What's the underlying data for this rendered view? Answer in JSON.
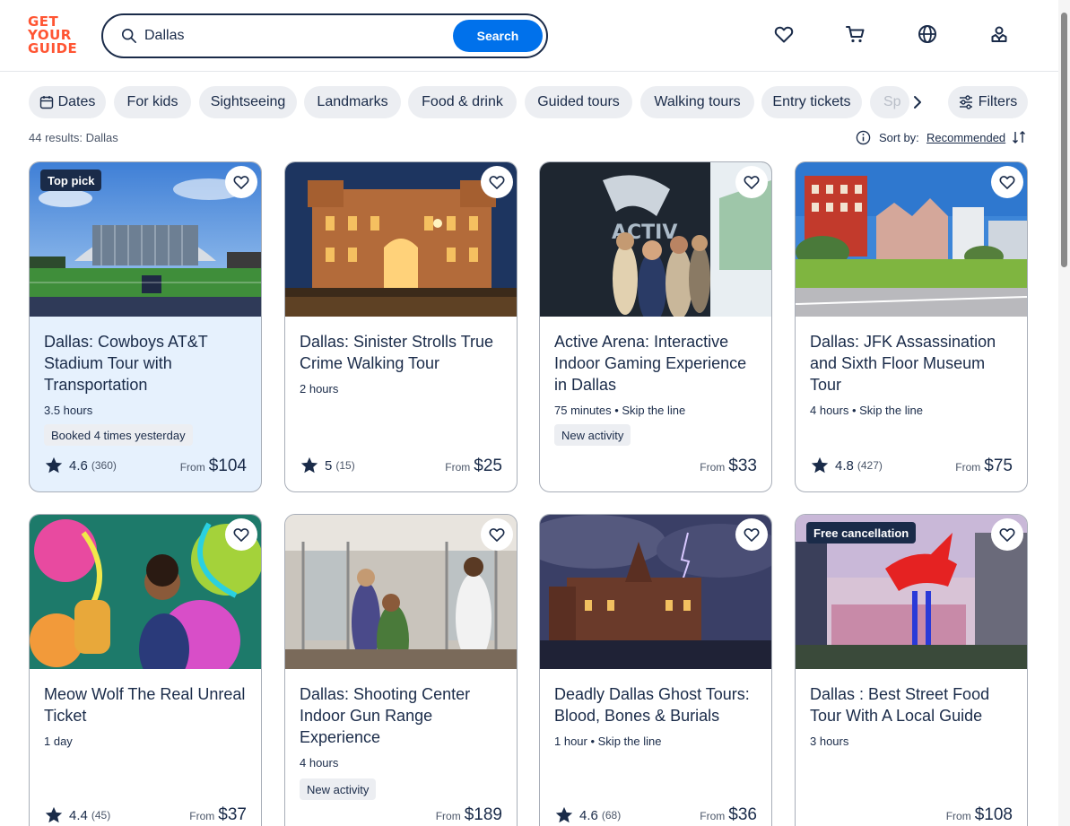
{
  "header": {
    "logo_lines": [
      "GET",
      "YOUR",
      "GUIDE"
    ],
    "search_value": "Dallas",
    "search_button": "Search",
    "icons": [
      "heart-icon",
      "cart-icon",
      "globe-icon",
      "profile-icon"
    ]
  },
  "filters": {
    "chips": [
      "Dates",
      "For kids",
      "Sightseeing",
      "Landmarks",
      "Food & drink",
      "Guided tours",
      "Walking tours",
      "Entry tickets",
      "Sp"
    ],
    "filters_label": "Filters"
  },
  "results": {
    "count_text": "44 results: Dallas",
    "sort_label": "Sort by:",
    "sort_value": "Recommended"
  },
  "cards": [
    {
      "title": "Dallas: Cowboys AT&T Stadium Tour with Transportation",
      "meta": "3.5 hours",
      "tag": "Booked 4 times yesterday",
      "badge": "Top pick",
      "rating": "4.6",
      "reviews": "(360)",
      "from": "From",
      "price": "$104"
    },
    {
      "title": "Dallas: Sinister Strolls True Crime Walking Tour",
      "meta": "2 hours",
      "tag": "",
      "badge": "",
      "rating": "5",
      "reviews": "(15)",
      "from": "From",
      "price": "$25"
    },
    {
      "title": "Active Arena: Interactive Indoor Gaming Experience in Dallas",
      "meta": "75 minutes • Skip the line",
      "tag": "New activity",
      "badge": "",
      "rating": "",
      "reviews": "",
      "from": "From",
      "price": "$33"
    },
    {
      "title": "Dallas: JFK Assassination and Sixth Floor Museum Tour",
      "meta": "4 hours • Skip the line",
      "tag": "",
      "badge": "",
      "rating": "4.8",
      "reviews": "(427)",
      "from": "From",
      "price": "$75"
    },
    {
      "title": "Meow Wolf The Real Unreal Ticket",
      "meta": "1 day",
      "tag": "",
      "badge": "",
      "rating": "4.4",
      "reviews": "(45)",
      "from": "From",
      "price": "$37"
    },
    {
      "title": "Dallas: Shooting Center Indoor Gun Range Experience",
      "meta": "4 hours",
      "tag": "New activity",
      "badge": "",
      "rating": "",
      "reviews": "",
      "from": "From",
      "price": "$189"
    },
    {
      "title": "Deadly Dallas Ghost Tours: Blood, Bones & Burials",
      "meta": "1 hour • Skip the line",
      "tag": "",
      "badge": "",
      "rating": "4.6",
      "reviews": "(68)",
      "from": "From",
      "price": "$36"
    },
    {
      "title": "Dallas : Best Street Food Tour With A Local Guide",
      "meta": "3 hours",
      "tag": "",
      "badge": "Free cancellation",
      "rating": "",
      "reviews": "",
      "from": "From",
      "price": "$108"
    }
  ],
  "colors": {
    "brand": "#ff5533",
    "accent": "#0071eb",
    "text": "#1a2b49",
    "highlight_card": "#e6f1fd"
  }
}
